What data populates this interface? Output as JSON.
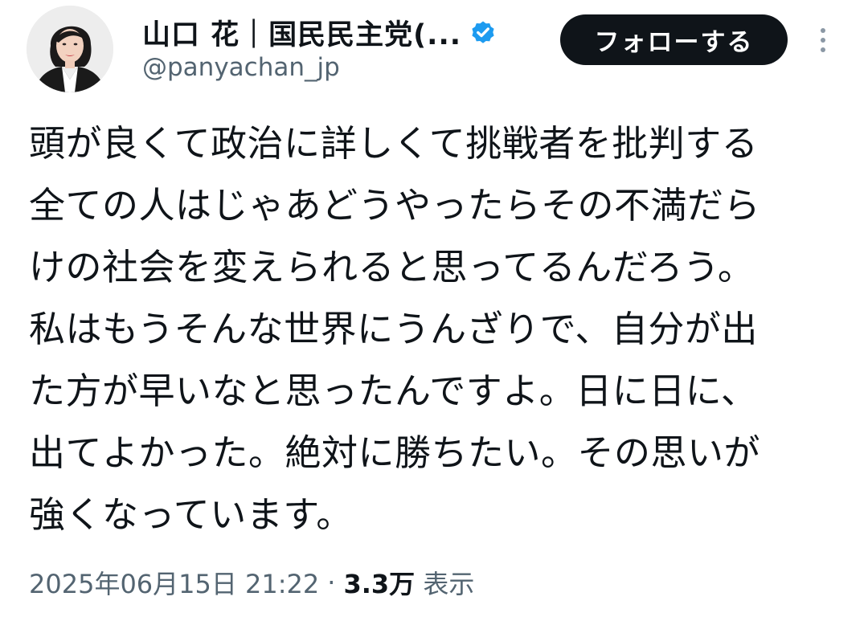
{
  "author": {
    "display_name": "山口 花｜国民民主党(...",
    "handle": "@panyachan_jp",
    "verified": true,
    "verified_color": "#1d9bf0"
  },
  "actions": {
    "follow_label": "フォローする"
  },
  "tweet": {
    "lines": [
      "頭が良くて政治に詳しくて挑戦者を批判する",
      "全ての人はじゃあどうやったらその不満だら",
      "けの社会を変えられると思ってるんだろう。",
      "私はもうそんな世界にうんざりで、自分が出",
      "た方が早いなと思ったんですよ。日に日に、",
      "出てよかった。絶対に勝ちたい。その思いが",
      "強くなっています。"
    ]
  },
  "meta": {
    "timestamp": "2025年06月15日 21:22",
    "separator": "·",
    "views_count": "3.3万",
    "views_label": "表示"
  },
  "colors": {
    "text": "#0f1419",
    "secondary": "#536471",
    "button_bg": "#0f1419",
    "button_text": "#ffffff"
  }
}
